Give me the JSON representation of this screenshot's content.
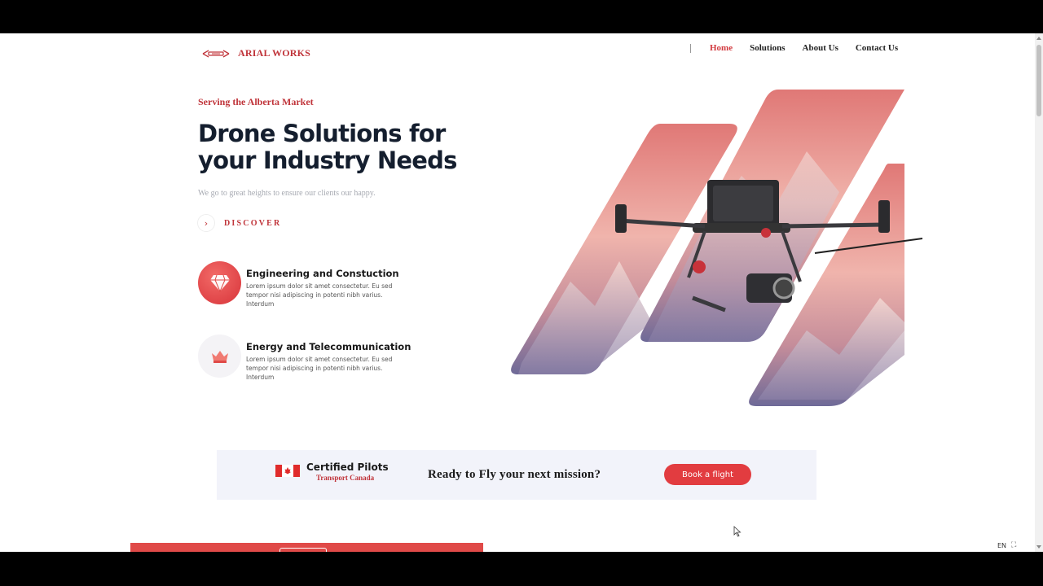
{
  "brand": {
    "name": "ARIAL WORKS"
  },
  "nav": {
    "items": [
      {
        "label": "Home",
        "active": true
      },
      {
        "label": "Solutions",
        "active": false
      },
      {
        "label": "About Us",
        "active": false
      },
      {
        "label": "Contact Us",
        "active": false
      }
    ]
  },
  "hero": {
    "eyebrow": "Serving the Alberta Market",
    "title": "Drone Solutions for your Industry Needs",
    "subtitle": "We go to great heights to ensure our clients our happy.",
    "discover_label": "DISCOVER"
  },
  "features": [
    {
      "title": "Engineering and Constuction",
      "description": "Lorem ipsum dolor sit amet consectetur. Eu sed tempor nisi adipiscing in potenti nibh varius. Interdum",
      "icon": "diamond-icon"
    },
    {
      "title": "Energy and Telecommunication",
      "description": "Lorem ipsum dolor sit amet consectetur. Eu sed tempor nisi adipiscing in potenti nibh varius. Interdum",
      "icon": "crown-icon"
    }
  ],
  "cta": {
    "cert_title": "Certified Pilots",
    "cert_subtitle": "Transport Canada",
    "question": "Ready to Fly your next mission?",
    "button_label": "Book a flight"
  },
  "language": "EN",
  "colors": {
    "accent": "#e23c40",
    "brand_red": "#c0343a",
    "heading": "#141e2e",
    "band": "#f2f3fa"
  }
}
